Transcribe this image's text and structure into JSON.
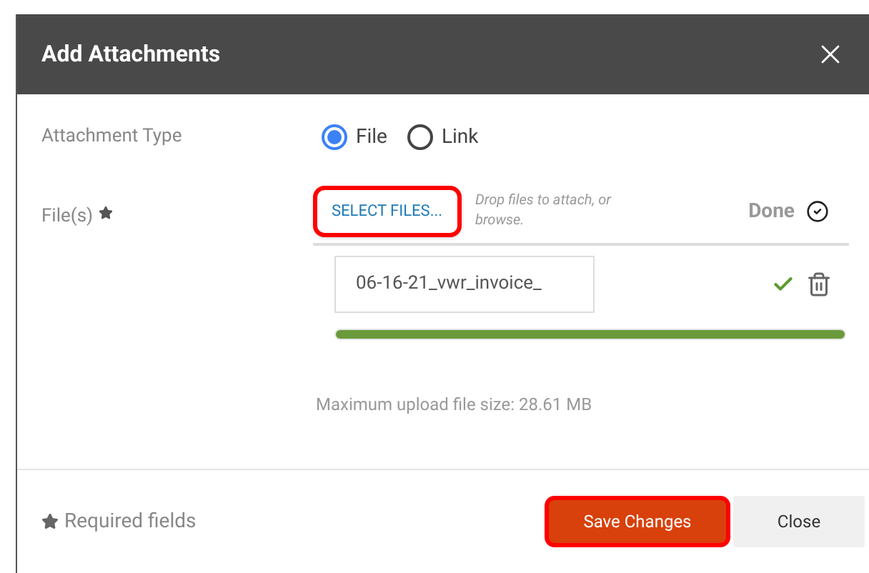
{
  "dialog": {
    "title": "Add Attachments"
  },
  "attachment_type": {
    "label": "Attachment Type",
    "options": [
      {
        "label": "File",
        "selected": true
      },
      {
        "label": "Link",
        "selected": false
      }
    ]
  },
  "files": {
    "label": "File(s)",
    "required": true,
    "select_button": "SELECT FILES...",
    "drop_hint": "Drop files to attach, or browse.",
    "status": "Done",
    "items": [
      {
        "name": "06-16-21_vwr_invoice_",
        "uploaded": true,
        "level": 1
      }
    ]
  },
  "max_size": "Maximum upload file size: 28.61 MB",
  "footer": {
    "required_note": "Required fields",
    "buttons": [
      {
        "label": "Save Changes",
        "kind": "primary",
        "highlighted": true
      },
      {
        "label": "Close",
        "kind": "secondary",
        "highlighted": false
      }
    ]
  }
}
